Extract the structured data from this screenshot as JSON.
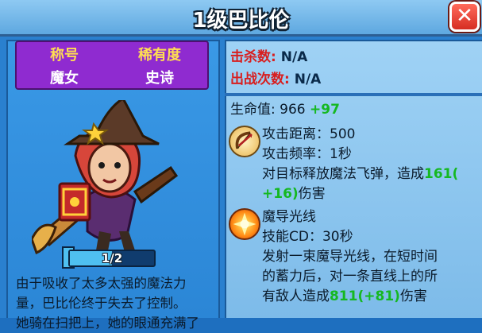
{
  "header": {
    "title": "1级巴比伦",
    "close_label": "✕"
  },
  "hero_info": {
    "title_label": "称号",
    "title_value": "魔女",
    "rarity_label": "稀有度",
    "rarity_value": "史诗"
  },
  "level": {
    "text": "1/2",
    "progress": 0.5
  },
  "description": [
    "由于吸收了太多太强的魔法力",
    "量，巴比伦终于失去了控制。",
    "她骑在扫把上，她的眼通充满了"
  ],
  "stats": {
    "kills_label": "击杀数:",
    "kills_value": "N/A",
    "battles_label": "出战次数:",
    "battles_value": "N/A",
    "hp_label": "生命值:",
    "hp_value": "966",
    "hp_bonus": "+97"
  },
  "attack": {
    "icon": "bow-icon",
    "lines": [
      {
        "text": "攻击距离：500"
      },
      {
        "text": "攻击频率：1秒"
      }
    ],
    "effect_prefix": "对目标释放魔法飞弹，造成",
    "effect_value": "161(",
    "effect_bonus": "+16)",
    "effect_suffix": "伤害"
  },
  "skill": {
    "icon": "light-beam-icon",
    "name": "魔导光线",
    "cd": "技能CD：30秒",
    "desc_line1": "发射一束魔导光线，在短时间",
    "desc_line2": "的蓄力后，对一条直线上的所",
    "desc_prefix": "有敌人造成",
    "desc_value": "811(+81)",
    "desc_suffix": "伤害"
  },
  "colors": {
    "background": "#2a80cf",
    "card": "#8f2bd0",
    "bonus": "#15b821",
    "stat_label": "#d81e1e"
  }
}
